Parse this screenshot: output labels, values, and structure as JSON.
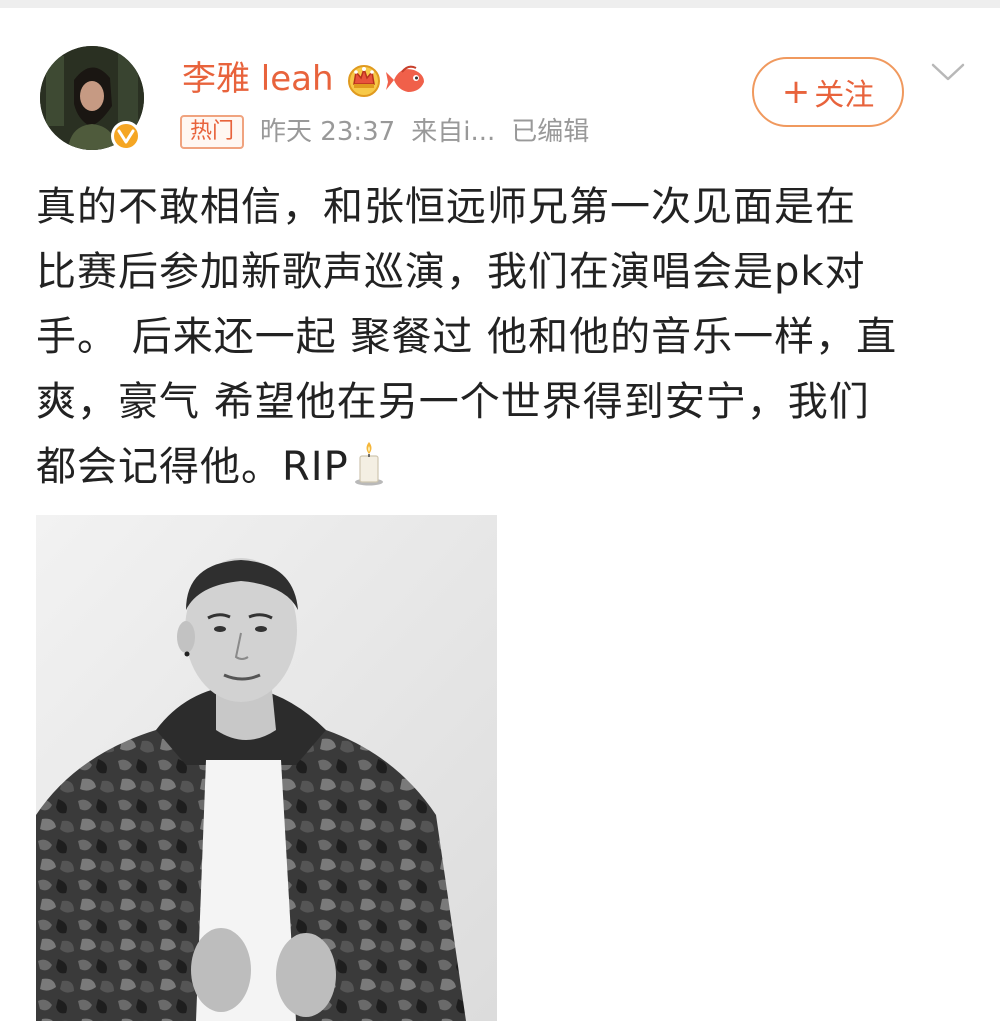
{
  "post": {
    "author": {
      "name": "李雅 leah",
      "avatar_icon": "avatar-photo",
      "verified_icon": "verified-badge-icon",
      "badges": [
        "crown-icon",
        "fish-icon"
      ]
    },
    "meta": {
      "hot_label": "热门",
      "time": "昨天 23:37",
      "source": "来自i...",
      "edited": "已编辑"
    },
    "follow_button": {
      "label": "关注",
      "plus": "+"
    },
    "menu_icon": "chevron-down-icon",
    "text_lines": [
      "真的不敢相信，和张恒远师兄第一次见面是在",
      "比赛后参加新歌声巡演，我们在演唱会是pk对",
      "手。 后来还一起 聚餐过 他和他的音乐一样，直",
      "爽，豪气 希望他在另一个世界得到安宁，我们",
      "都会记得他。RIP"
    ],
    "end_emoji": "candle-icon",
    "image": {
      "description_icon": "black-and-white-portrait-photo"
    }
  },
  "colors": {
    "accent": "#e8633c",
    "follow_border": "#f0995e",
    "meta_gray": "#999999",
    "text": "#222222",
    "verified": "#f5a623"
  }
}
